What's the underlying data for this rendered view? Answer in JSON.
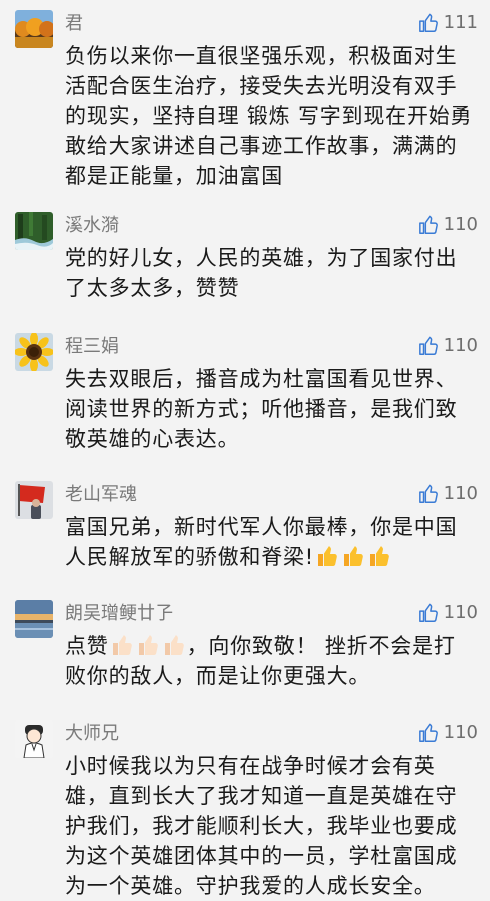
{
  "comments": [
    {
      "avatar_icon": "autumn-trees-avatar",
      "username": "君",
      "likes": "111",
      "lines": [
        "负伤以来你一直很坚强乐观，积极面对生",
        "活配合医生治疗，接受失去光明没有双手",
        "的现实，坚持自理 锻炼 写字到现在开始勇",
        "敢给大家讲述自己事迹工作故事，满满的",
        "都是正能量，加油富国"
      ]
    },
    {
      "avatar_icon": "forest-stream-avatar",
      "username": "溪水漪",
      "likes": "110",
      "lines": [
        "党的好儿女，人民的英雄，为了国家付出",
        "了太多太多，赞赞"
      ]
    },
    {
      "avatar_icon": "sunflower-avatar",
      "username": "程三娟",
      "likes": "110",
      "lines": [
        "失去双眼后，播音成为杜富国看见世界、",
        "阅读世界的新方式；听他播音，是我们致",
        "敬英雄的心表达。"
      ]
    },
    {
      "avatar_icon": "red-flag-avatar",
      "username": "老山军魂",
      "likes": "110",
      "lines": [
        "富国兄弟，新时代军人你最棒，你是中国",
        "人民解放军的骄傲和脊梁!"
      ],
      "line2_emoji": [
        "thumbs-up-emoji",
        "thumbs-up-emoji",
        "thumbs-up-emoji"
      ]
    },
    {
      "avatar_icon": "lake-sunset-avatar",
      "username": "朗吴璔鲠廿孒",
      "likes": "110",
      "line1_prefix": "点赞",
      "line1_emoji": [
        "thumbs-up-light-emoji",
        "thumbs-up-light-emoji",
        "thumbs-up-light-emoji"
      ],
      "line1_suffix": "，向你致敬！ 挫折不会是打",
      "lines": [
        "败你的敌人，而是让你更强大。"
      ]
    },
    {
      "avatar_icon": "cartoon-person-avatar",
      "username": "大师兄",
      "likes": "110",
      "lines": [
        "小时候我以为只有在战争时候才会有英",
        "雄，直到长大了我才知道一直是英雄在守",
        "护我们，我才能顺利长大，我毕业也要成",
        "为这个英雄团体其中的一员，学杜富国成",
        "为一个英雄。守护我爱的人成长安全。"
      ]
    }
  ],
  "colors": {
    "background": "#f3f3f3",
    "username": "#7a7a7a",
    "text": "#1a1a1a",
    "like_icon": "#3a7bd5",
    "like_count": "#6e6e6e"
  }
}
